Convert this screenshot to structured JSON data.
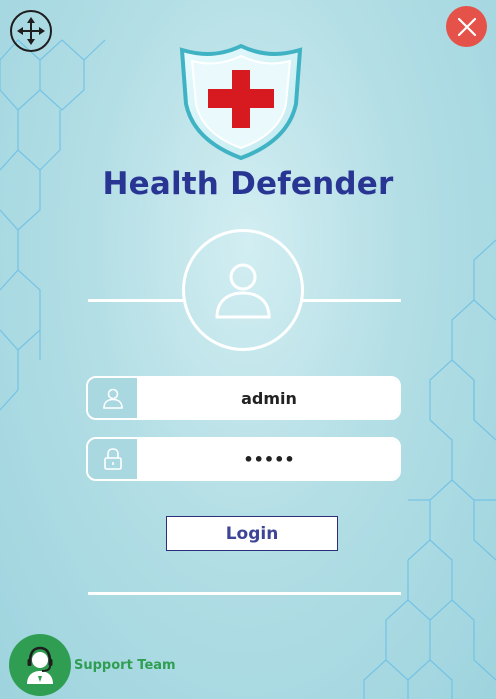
{
  "app": {
    "title": "Health Defender"
  },
  "window": {
    "move_icon": "move-arrows-icon",
    "close_icon": "close-x-icon"
  },
  "login_form": {
    "username_value": "admin",
    "password_value": "•••••",
    "login_label": "Login"
  },
  "support": {
    "label": "Support Team",
    "icon": "headset-agent-icon"
  },
  "colors": {
    "title": "#283593",
    "close": "#e5524a",
    "shield_cross": "#d71920",
    "support": "#2f9e52",
    "hex_lines": "#6cbfe6"
  }
}
